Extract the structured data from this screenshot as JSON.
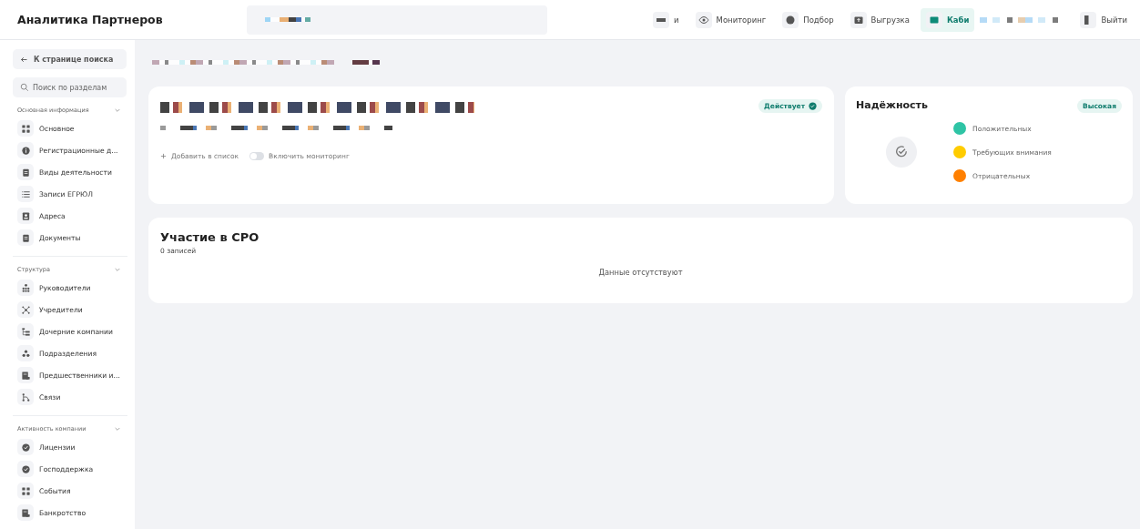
{
  "app": {
    "title": "Аналитика Партнеров"
  },
  "nav": [
    {
      "label": "и",
      "selected": false
    },
    {
      "label": "Мониторинг",
      "selected": false
    },
    {
      "label": "Подбор",
      "selected": false
    },
    {
      "label": "Выгрузка",
      "selected": false
    },
    {
      "label": "Каби",
      "selected": true
    },
    {
      "label": "Выйти",
      "selected": false
    }
  ],
  "sidebar": {
    "back": "К странице поиска",
    "search": {
      "placeholder": "Поиск по разделам"
    },
    "sections": [
      {
        "title": "Основная информация",
        "expanded": true,
        "items": [
          "Основное",
          "Регистрационные д...",
          "Виды деятельности",
          "Записи ЕГРЮЛ",
          "Адреса",
          "Документы"
        ]
      },
      {
        "title": "Структура",
        "expanded": true,
        "items": [
          "Руководители",
          "Учредители",
          "Дочерние компании",
          "Подразделения",
          "Предшественники и...",
          "Связи"
        ]
      },
      {
        "title": "Активность компании",
        "expanded": true,
        "items": [
          "Лицензии",
          "Господдержка",
          "События",
          "Банкротство"
        ]
      }
    ]
  },
  "company": {
    "status": "Действует",
    "add_to_list": "Добавить в список",
    "monitoring": {
      "label": "Включить мониторинг",
      "on": false
    }
  },
  "reliability": {
    "title": "Надёжность",
    "rating": "Высокая",
    "legend": [
      {
        "label": "Положительных",
        "color": "#2ec4a5"
      },
      {
        "label": "Требующих внимания",
        "color": "#ffcc00"
      },
      {
        "label": "Отрицательных",
        "color": "#ff8000"
      }
    ]
  },
  "sro": {
    "title": "Участие в СРО",
    "count": "0 записей",
    "empty": "Данные отсутствуют"
  }
}
